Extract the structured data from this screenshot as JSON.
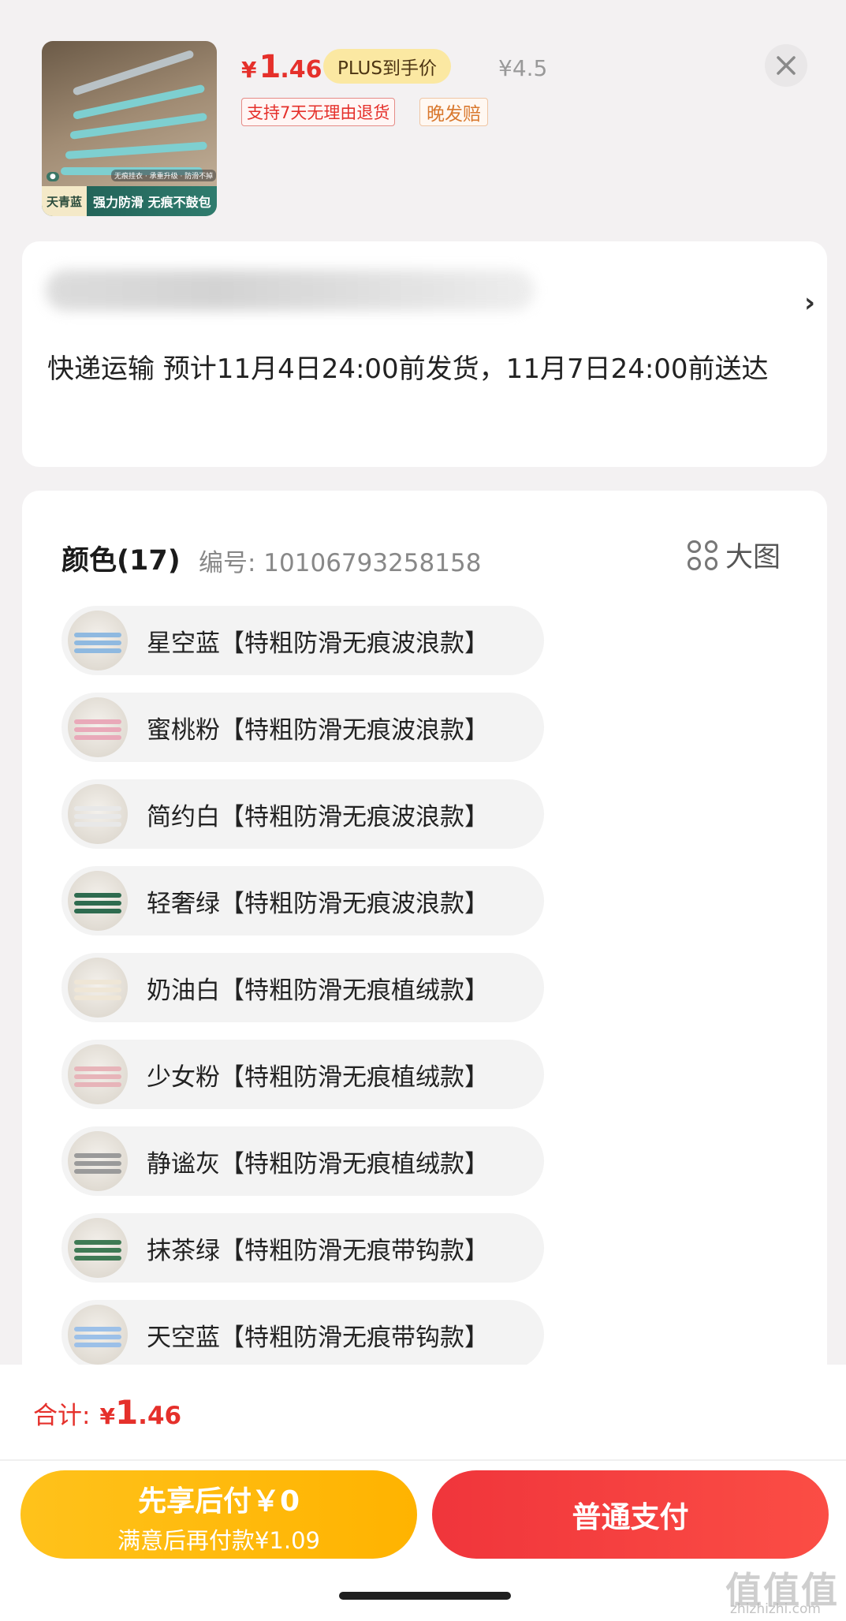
{
  "product": {
    "thumb_tag_left": "天青蓝",
    "thumb_tag_right": "强力防滑 无痕不鼓包",
    "thumb_features": "无痕挂衣 · 承重升级 · 防滑不掉",
    "price_currency": "¥",
    "price_int": "1",
    "price_dec": ".46",
    "plus_label": "PLUS到手价",
    "original_price": "¥4.5",
    "tag_return": "支持7天无理由退货",
    "tag_late": "晚发赔"
  },
  "address": {
    "shipping_text": "快递运输 预计11月4日24:00前发货，11月7日24:00前送达"
  },
  "colors": {
    "title": "颜色(17)",
    "code": "编号: 10106793258158",
    "big_view_label": "大图",
    "options": [
      {
        "label": "星空蓝【特粗防滑无痕波浪款】",
        "swatch": "#8fb9e0"
      },
      {
        "label": "蜜桃粉【特粗防滑无痕波浪款】",
        "swatch": "#e9a9b9"
      },
      {
        "label": "简约白【特粗防滑无痕波浪款】",
        "swatch": "#e8e8e8"
      },
      {
        "label": "轻奢绿【特粗防滑无痕波浪款】",
        "swatch": "#2e6b4f"
      },
      {
        "label": "奶油白【特粗防滑无痕植绒款】",
        "swatch": "#efe6d6"
      },
      {
        "label": "少女粉【特粗防滑无痕植绒款】",
        "swatch": "#e7b4b9"
      },
      {
        "label": "静谧灰【特粗防滑无痕植绒款】",
        "swatch": "#9a9a9a"
      },
      {
        "label": "抹茶绿【特粗防滑无痕带钩款】",
        "swatch": "#3f7a55"
      },
      {
        "label": "天空蓝【特粗防滑无痕带钩款】",
        "swatch": "#9cc0e8"
      }
    ]
  },
  "footer": {
    "total_label": "合计:",
    "total_currency": "¥",
    "total_int": "1",
    "total_dec": ".46",
    "later_pay_line1": "先享后付￥0",
    "later_pay_line2": "满意后再付款¥1.09",
    "normal_pay": "普通支付",
    "watermark": "值值值",
    "watermark_sub": "zhizhizhi.com"
  }
}
